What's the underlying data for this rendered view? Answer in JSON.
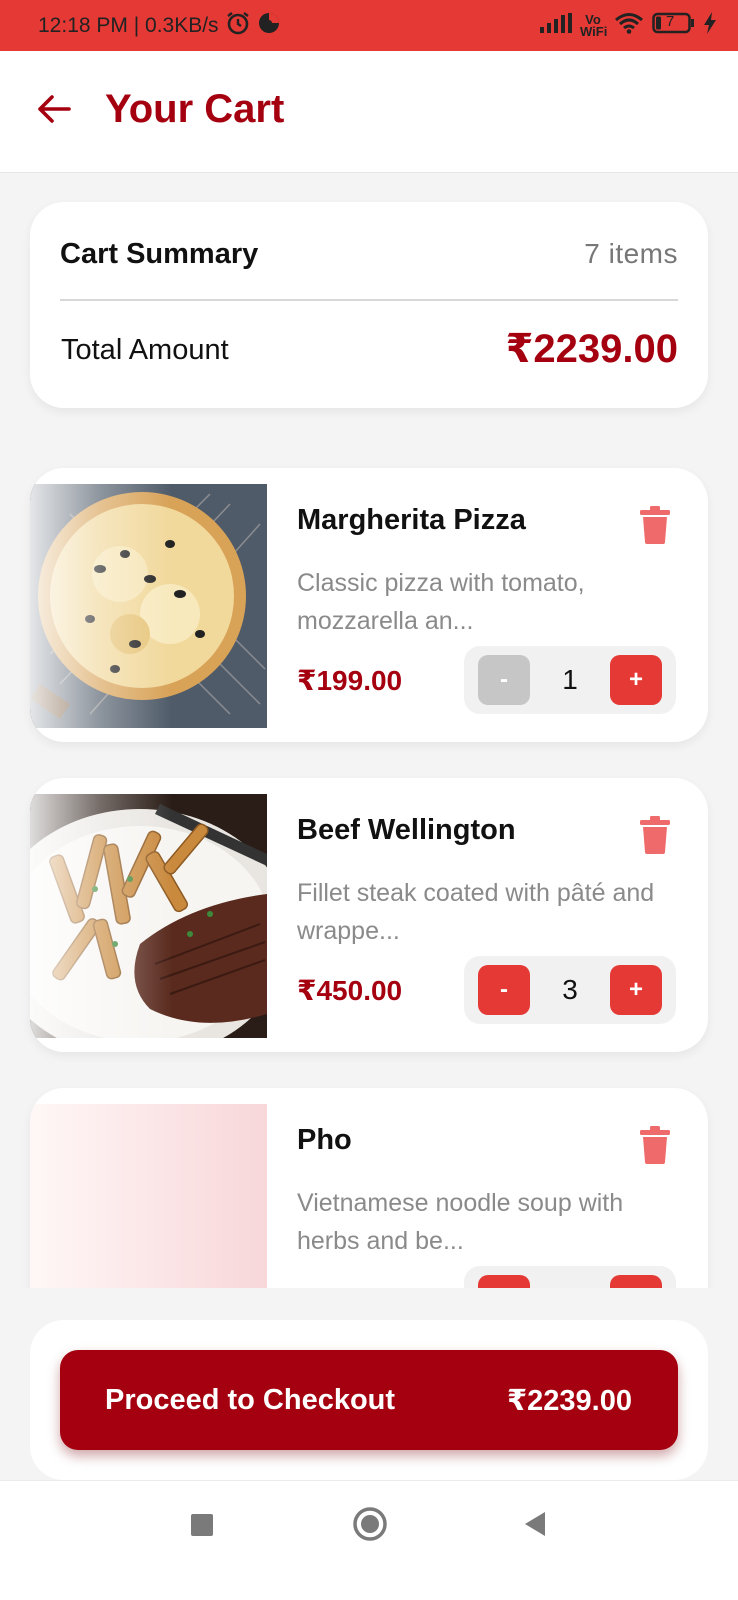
{
  "status_bar": {
    "time_speed": "12:18 PM | 0.3KB/s",
    "vo_wifi": "Vo WiFi",
    "battery": "7"
  },
  "header": {
    "title": "Your Cart"
  },
  "summary": {
    "title": "Cart Summary",
    "item_count": "7 items",
    "total_label": "Total Amount",
    "total_value": "₹2239.00"
  },
  "items": [
    {
      "name": "Margherita Pizza",
      "description": "Classic pizza with tomato, mozzarella an...",
      "price": "₹199.00",
      "quantity": "1",
      "minus_label": "-",
      "plus_label": "+"
    },
    {
      "name": "Beef Wellington",
      "description": "Fillet steak coated with pâté and wrappe...",
      "price": "₹450.00",
      "quantity": "3",
      "minus_label": "-",
      "plus_label": "+"
    },
    {
      "name": "Pho",
      "description": "Vietnamese noodle soup with herbs and be...",
      "price": "",
      "quantity": "",
      "minus_label": "-",
      "plus_label": "+"
    }
  ],
  "checkout": {
    "label": "Proceed to Checkout",
    "total": "₹2239.00"
  },
  "colors": {
    "brand_dark": "#a5000f",
    "brand_accent": "#e53935",
    "status_bar": "#e53935"
  },
  "icons": {
    "back": "arrow-left-icon",
    "delete": "trash-icon",
    "nav_recent": "square-icon",
    "nav_home": "circle-icon",
    "nav_back": "triangle-back-icon"
  }
}
